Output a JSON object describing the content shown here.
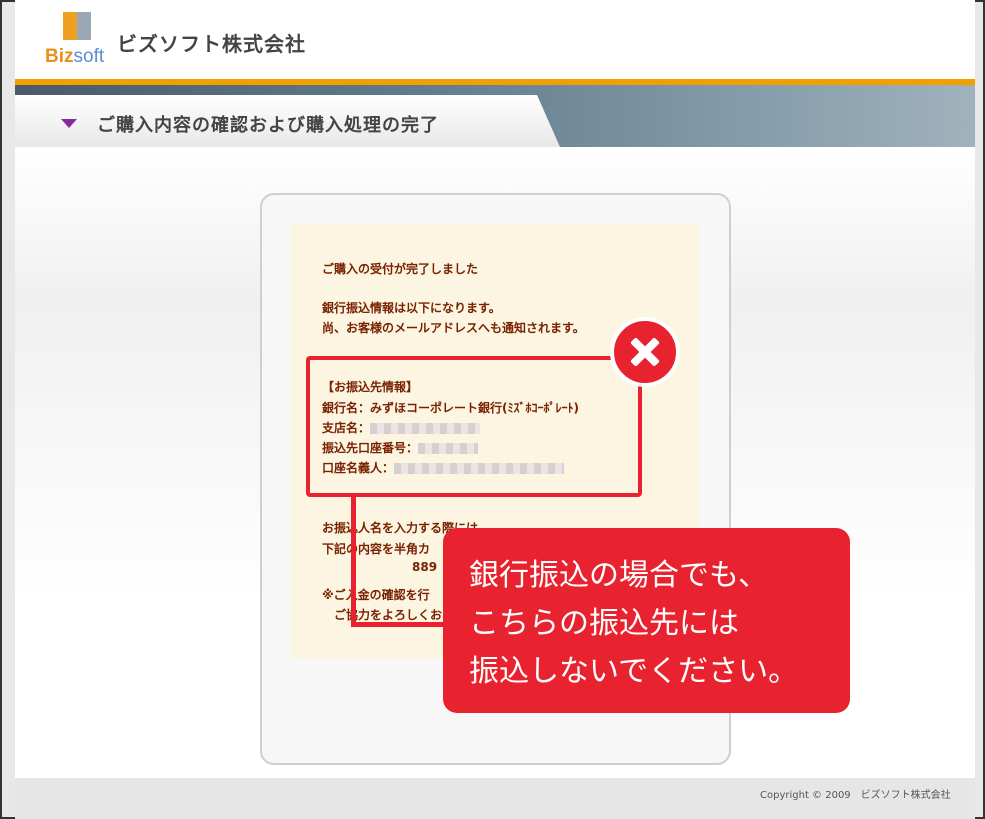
{
  "header": {
    "logo_biz": "Biz",
    "logo_soft": "soft",
    "company_name": "ビズソフト株式会社"
  },
  "title_bar": {
    "title": "ご購入内容の確認および購入処理の完了"
  },
  "content": {
    "line1": "ご購入の受付が完了しました",
    "line2": "銀行振込情報は以下になります。",
    "line3": "尚、お客様のメールアドレスへも通知されます。",
    "section_heading": "【お振込先情報】",
    "bank_label": "銀行名：",
    "bank_value": "みずほコーポレート銀行(ﾐｽﾞﾎｺｰﾎﾟﾚｰﾄ)",
    "branch_label": "支店名：",
    "account_no_label": "振込先口座番号：",
    "account_name_label": "口座名義人：",
    "note1": "お振込人名を入力する際には",
    "note2": "下記の内容を半角カ",
    "note3": "889",
    "note4": "※ご入金の確認を行",
    "note5": "ご協力をよろしくお"
  },
  "callout": {
    "line1": "銀行振込の場合でも、",
    "line2": "こちらの振込先には",
    "line3": "振込しないでください。"
  },
  "footer": {
    "copyright": "Copyright © 2009　ビズソフト株式会社"
  },
  "colors": {
    "accent_orange": "#f0a000",
    "warning_red": "#e8232f",
    "text_brown": "#7a2200"
  }
}
